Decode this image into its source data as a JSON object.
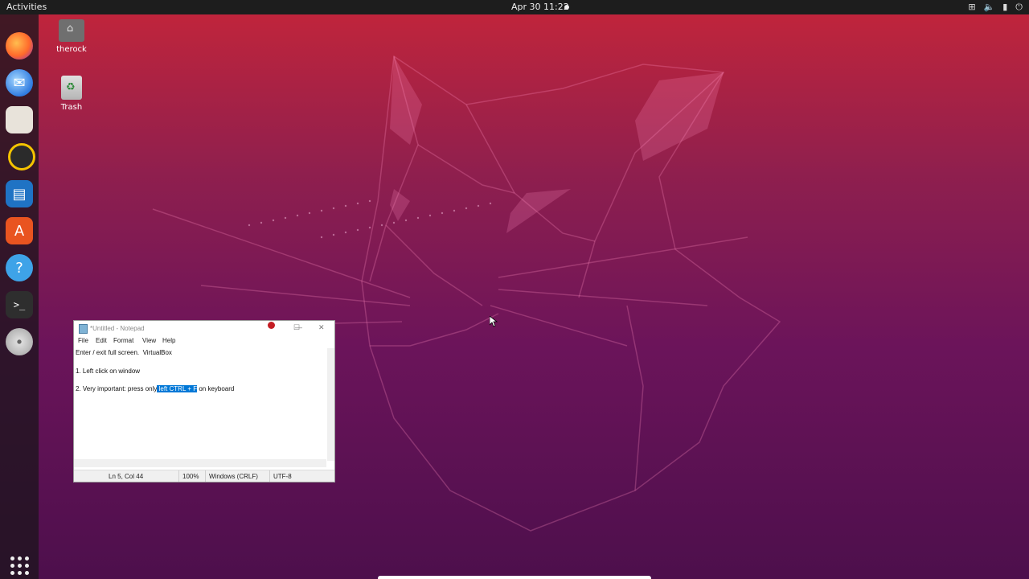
{
  "topbar": {
    "activities": "Activities",
    "clock": "Apr 30  11:22",
    "tray_icons": [
      "network-icon",
      "volume-icon",
      "battery-icon",
      "power-icon"
    ]
  },
  "dock": {
    "items": [
      "firefox-icon",
      "thunderbird-icon",
      "files-icon",
      "rhythmbox-icon",
      "libreoffice-writer-icon",
      "ubuntu-software-icon",
      "help-icon",
      "terminal-icon",
      "dvd-icon",
      "show-applications-icon"
    ]
  },
  "desktop": {
    "home_label": "therock",
    "trash_label": "Trash"
  },
  "notepad": {
    "title": "*Untitled - Notepad",
    "menu": [
      "File",
      "Edit",
      "Format",
      "View",
      "Help"
    ],
    "lines": {
      "l1": "Enter / exit full screen.  VirtualBox",
      "l2": "",
      "l3": "1. Left click on window",
      "l4": "",
      "l5_prefix": "2. Very important: press only",
      "l5_selected": " left CTRL + F",
      "l5_suffix": " on keyboard"
    },
    "status": {
      "position": "Ln 5, Col 44",
      "zoom": "100%",
      "line_ending": "Windows (CRLF)",
      "encoding": "UTF-8"
    }
  },
  "colors": {
    "wallpaper_top": "#c4253a",
    "wallpaper_bottom": "#4d0f4c",
    "selection": "#0078d7",
    "topbar": "#1d1d1d"
  }
}
